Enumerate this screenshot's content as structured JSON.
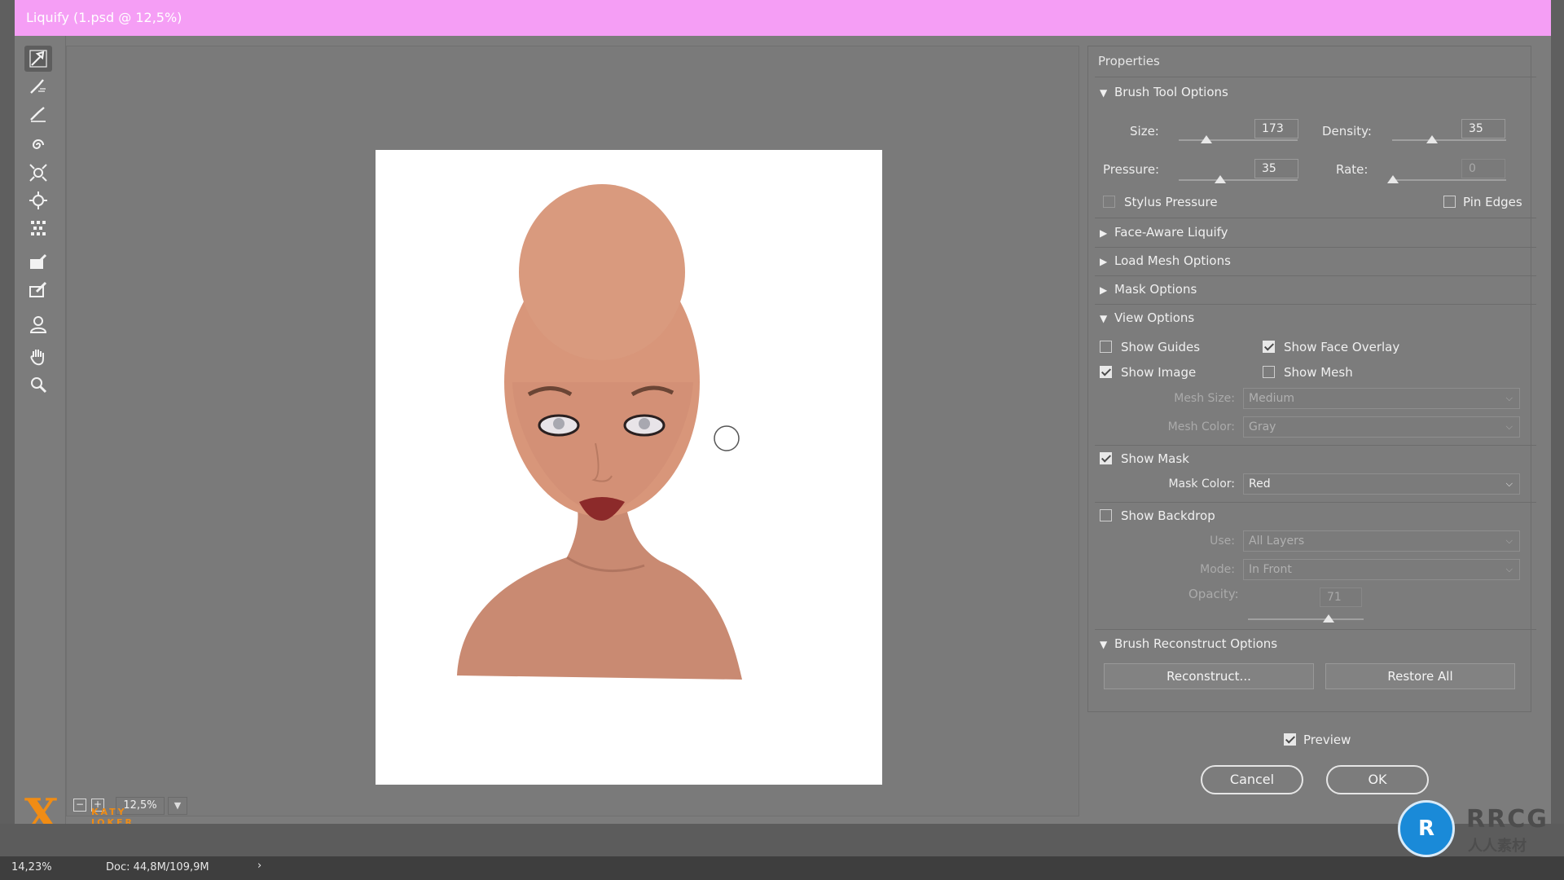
{
  "window": {
    "title": "Liquify (1.psd @ 12,5%)"
  },
  "tools": [
    {
      "name": "forward-warp-tool-icon"
    },
    {
      "name": "reconstruct-tool-icon"
    },
    {
      "name": "smooth-tool-icon"
    },
    {
      "name": "twirl-clockwise-tool-icon"
    },
    {
      "name": "pucker-tool-icon"
    },
    {
      "name": "bloat-tool-icon"
    },
    {
      "name": "push-left-tool-icon"
    },
    {
      "name": "freeze-mask-tool-icon"
    },
    {
      "name": "thaw-mask-tool-icon"
    },
    {
      "name": "face-tool-icon"
    },
    {
      "name": "hand-tool-icon"
    },
    {
      "name": "zoom-tool-icon"
    }
  ],
  "canvas": {
    "zoom": "12,5%"
  },
  "properties": {
    "title": "Properties",
    "brush_tool_options": {
      "title": "Brush Tool Options",
      "size_label": "Size:",
      "size": "173",
      "size_level": 0.17,
      "density_label": "Density:",
      "density": "35",
      "density_level": 0.35,
      "pressure_label": "Pressure:",
      "pressure": "35",
      "pressure_level": 0.35,
      "rate_label": "Rate:",
      "rate": "0",
      "rate_level": 0.0,
      "stylus_pressure": "Stylus Pressure",
      "pin_edges": "Pin Edges"
    },
    "face_aware": "Face-Aware Liquify",
    "load_mesh": "Load Mesh Options",
    "mask_options": "Mask Options",
    "view_options": {
      "title": "View Options",
      "show_guides": "Show Guides",
      "show_face_overlay": "Show Face Overlay",
      "show_image": "Show Image",
      "show_mesh": "Show Mesh",
      "mesh_size_label": "Mesh Size:",
      "mesh_size": "Medium",
      "mesh_color_label": "Mesh Color:",
      "mesh_color": "Gray",
      "show_mask": "Show Mask",
      "mask_color_label": "Mask Color:",
      "mask_color": "Red",
      "show_backdrop": "Show Backdrop",
      "use_label": "Use:",
      "use": "All Layers",
      "mode_label": "Mode:",
      "mode": "In Front",
      "opacity_label": "Opacity:",
      "opacity": "71",
      "opacity_level": 0.71
    },
    "brush_reconstruct": {
      "title": "Brush Reconstruct Options",
      "reconstruct": "Reconstruct...",
      "restore_all": "Restore All"
    }
  },
  "footer": {
    "preview": "Preview",
    "cancel": "Cancel",
    "ok": "OK"
  },
  "status": {
    "zoom": "14,23%",
    "doc": "Doc: 44,8M/109,9M",
    "arrow": "›"
  },
  "logo_left": {
    "mark": "X",
    "line1": "KATY",
    "line2": "JOKER"
  },
  "logo_right": {
    "mark": "R",
    "line1": "RRCG",
    "line2": "人人素材"
  },
  "colors": {
    "title_bar": "#f59ef5",
    "dialog": "#7c7c7c",
    "skin": "#d8967a"
  }
}
